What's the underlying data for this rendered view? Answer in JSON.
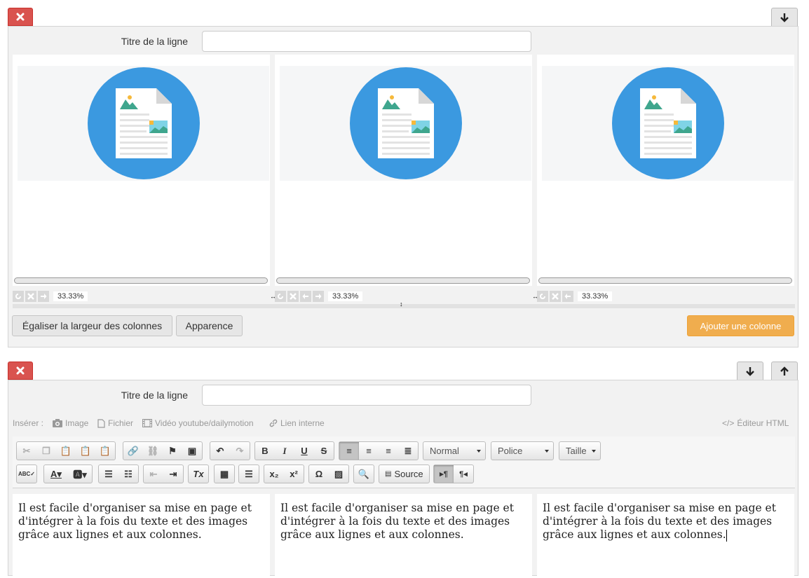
{
  "row1": {
    "title_label": "Titre de la ligne",
    "title_value": "",
    "columns": [
      {
        "width": "33.33%"
      },
      {
        "width": "33.33%"
      },
      {
        "width": "33.33%"
      }
    ],
    "equalize_button": "Égaliser la largeur des colonnes",
    "appearance_button": "Apparence",
    "add_column_button": "Ajouter une colonne"
  },
  "row2": {
    "title_label": "Titre de la ligne",
    "title_value": "",
    "insert": {
      "label": "Insérer :",
      "image": "Image",
      "file": "Fichier",
      "video": "Vidéo youtube/dailymotion",
      "internal_link": "Lien interne",
      "html_editor": "Éditeur HTML"
    },
    "toolbar": {
      "format": "Normal",
      "font": "Police",
      "size": "Taille",
      "source": "Source",
      "ltr": "▸¶",
      "rtl": "¶◂"
    },
    "columns": [
      {
        "text": "Il est facile d'organiser sa mise en page et d'intégrer à la fois du texte et des images grâce aux lignes et aux colonnes."
      },
      {
        "text": "Il est facile d'organiser sa mise en page et d'intégrer à la fois du texte et des images grâce aux lignes et aux colonnes."
      },
      {
        "text": "Il est facile d'organiser sa mise en page et d'intégrer à la fois du texte et des images grâce aux lignes et aux colonnes."
      }
    ]
  },
  "colors": {
    "danger": "#d9534f",
    "warning": "#f0ad4e",
    "accent": "#3b99e0"
  }
}
